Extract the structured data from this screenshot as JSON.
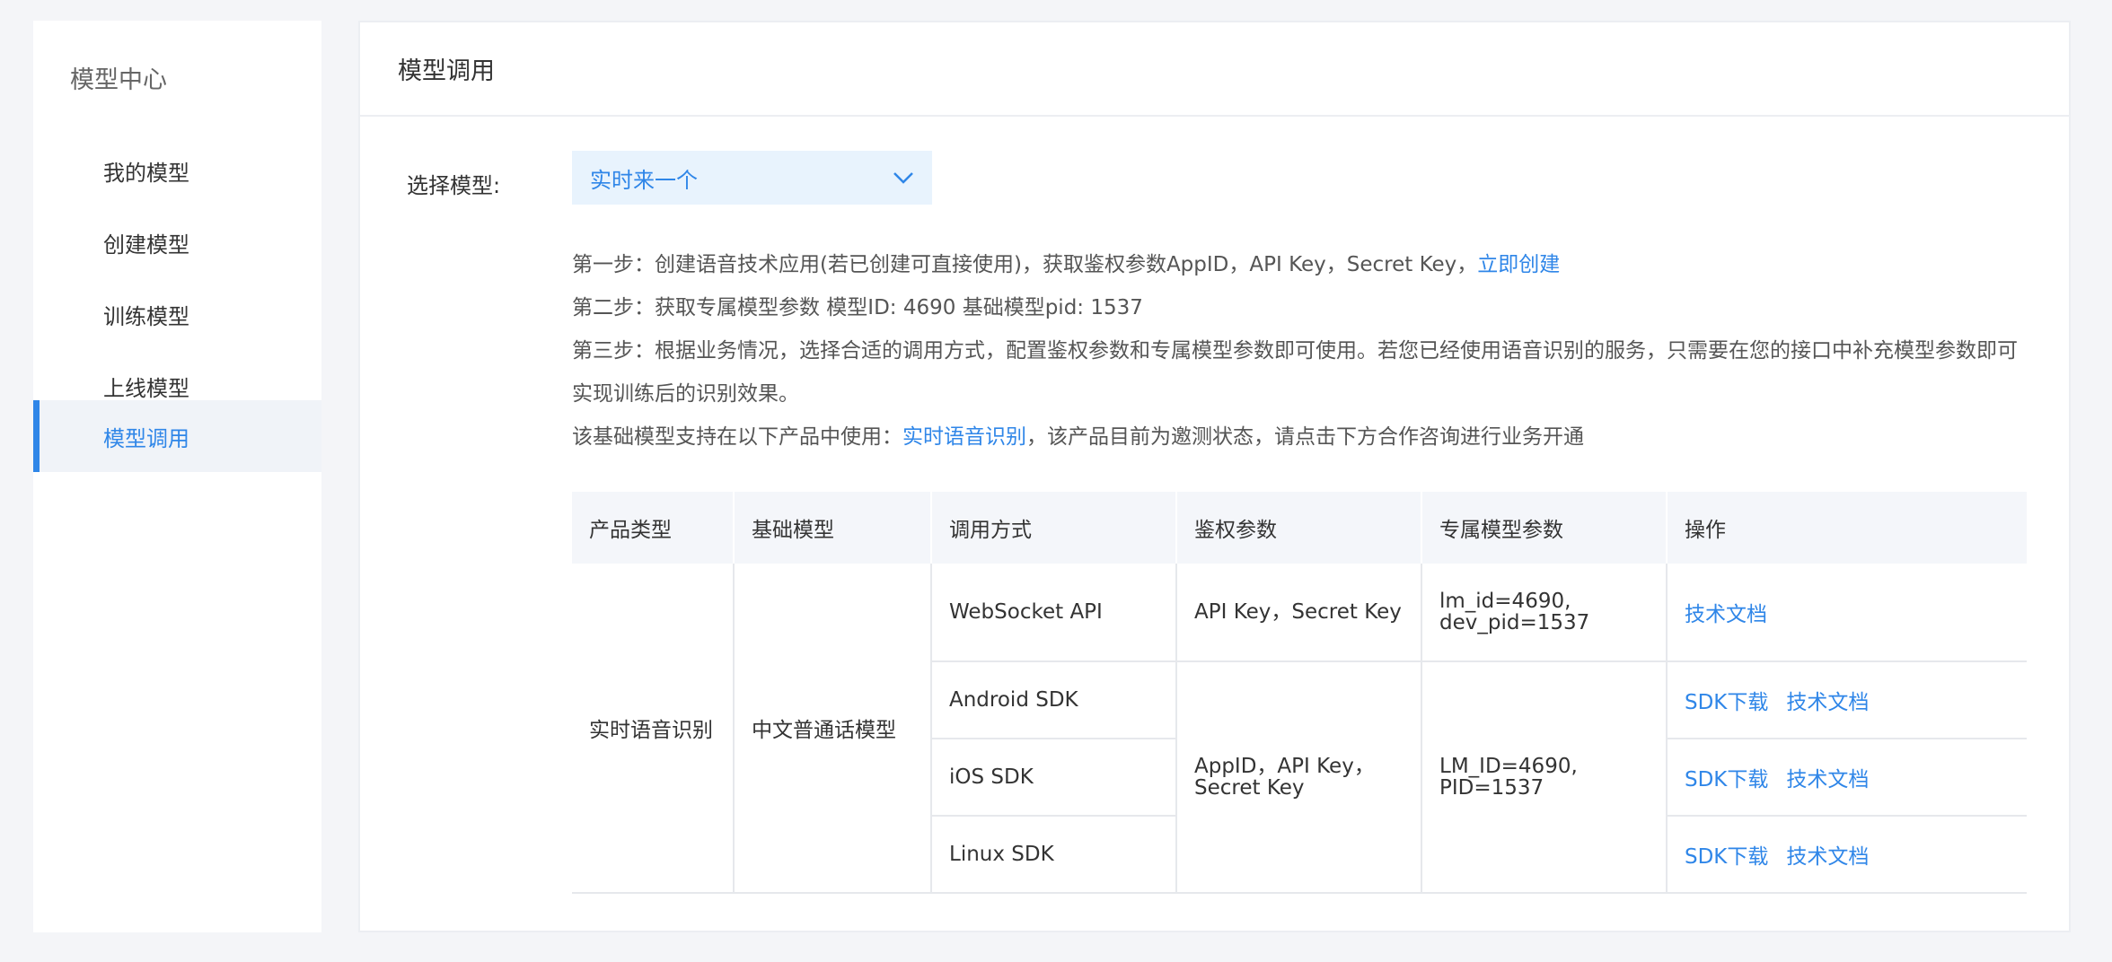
{
  "sidebar": {
    "title": "模型中心",
    "items": [
      {
        "label": "我的模型"
      },
      {
        "label": "创建模型"
      },
      {
        "label": "训练模型"
      },
      {
        "label": "上线模型"
      },
      {
        "label": "模型调用",
        "active": true
      }
    ]
  },
  "main": {
    "title": "模型调用",
    "select_label": "选择模型:",
    "select_value": "实时来一个",
    "steps": {
      "step1_text": "第一步：创建语音技术应用(若已创建可直接使用)，获取鉴权参数AppID，API Key，Secret Key，",
      "step1_link": "立即创建",
      "step2_text": "第二步：获取专属模型参数 模型ID: 4690   基础模型pid: 1537",
      "step3_text": "第三步：根据业务情况，选择合适的调用方式，配置鉴权参数和专属模型参数即可使用。若您已经使用语音识别的服务，只需要在您的接口中补充模型参数即可实现训练后的识别效果。",
      "note_prefix": "该基础模型支持在以下产品中使用：",
      "note_link": "实时语音识别",
      "note_suffix": "，该产品目前为邀测状态，请点击下方合作咨询进行业务开通"
    },
    "table": {
      "headers": [
        "产品类型",
        "基础模型",
        "调用方式",
        "鉴权参数",
        "专属模型参数",
        "操作"
      ],
      "product_type": "实时语音识别",
      "base_model": "中文普通话模型",
      "rows": [
        {
          "method": "WebSocket API",
          "auth": "API Key，Secret Key",
          "params": "lm_id=4690, dev_pid=1537",
          "doc": "技术文档"
        },
        {
          "method": "Android SDK",
          "sdk": "SDK下载",
          "doc": "技术文档"
        },
        {
          "method": "iOS SDK",
          "sdk": "SDK下载",
          "doc": "技术文档"
        },
        {
          "method": "Linux SDK",
          "sdk": "SDK下载",
          "doc": "技术文档"
        }
      ],
      "sdk_auth": "AppID，API Key，Secret Key",
      "sdk_params": "LM_ID=4690, PID=1537"
    }
  },
  "colors": {
    "accent": "#2f86e8",
    "background": "#f4f5f8"
  }
}
